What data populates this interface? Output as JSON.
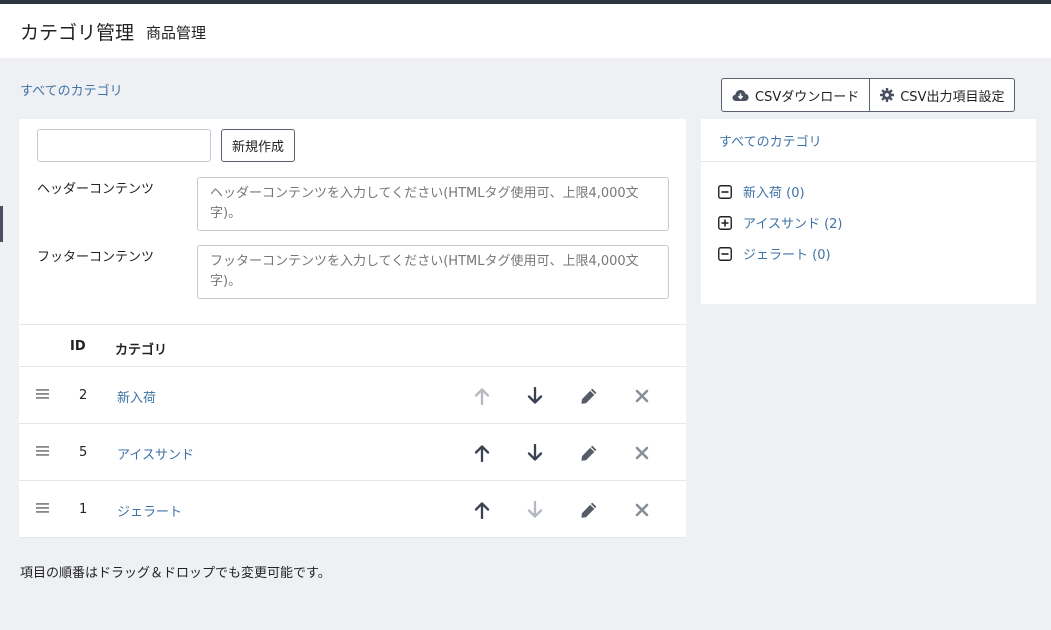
{
  "header": {
    "title": "カテゴリ管理",
    "subtitle": "商品管理"
  },
  "breadcrumb": "すべてのカテゴリ",
  "toolbar": {
    "csv_download": "CSVダウンロード",
    "csv_settings": "CSV出力項目設定"
  },
  "form": {
    "name_value": "",
    "new_button": "新規作成",
    "header_label": "ヘッダーコンテンツ",
    "header_placeholder": "ヘッダーコンテンツを入力してください(HTMLタグ使用可、上限4,000文字)。",
    "footer_label": "フッターコンテンツ",
    "footer_placeholder": "フッターコンテンツを入力してください(HTMLタグ使用可、上限4,000文字)。"
  },
  "table": {
    "col_id": "ID",
    "col_category": "カテゴリ",
    "rows": [
      {
        "id": "2",
        "name": "新入荷"
      },
      {
        "id": "5",
        "name": "アイスサンド"
      },
      {
        "id": "1",
        "name": "ジェラート"
      }
    ]
  },
  "note": "項目の順番はドラッグ＆ドロップでも変更可能です。",
  "tree": {
    "root": "すべてのカテゴリ",
    "items": [
      {
        "label": "新入荷 (0)",
        "icon": "minus-square-icon"
      },
      {
        "label": "アイスサンド (2)",
        "icon": "plus-square-icon"
      },
      {
        "label": "ジェラート (0)",
        "icon": "minus-square-icon"
      }
    ]
  },
  "colors": {
    "link": "#3f73a6",
    "background": "#eef0f4",
    "topbar": "#2c3440"
  }
}
